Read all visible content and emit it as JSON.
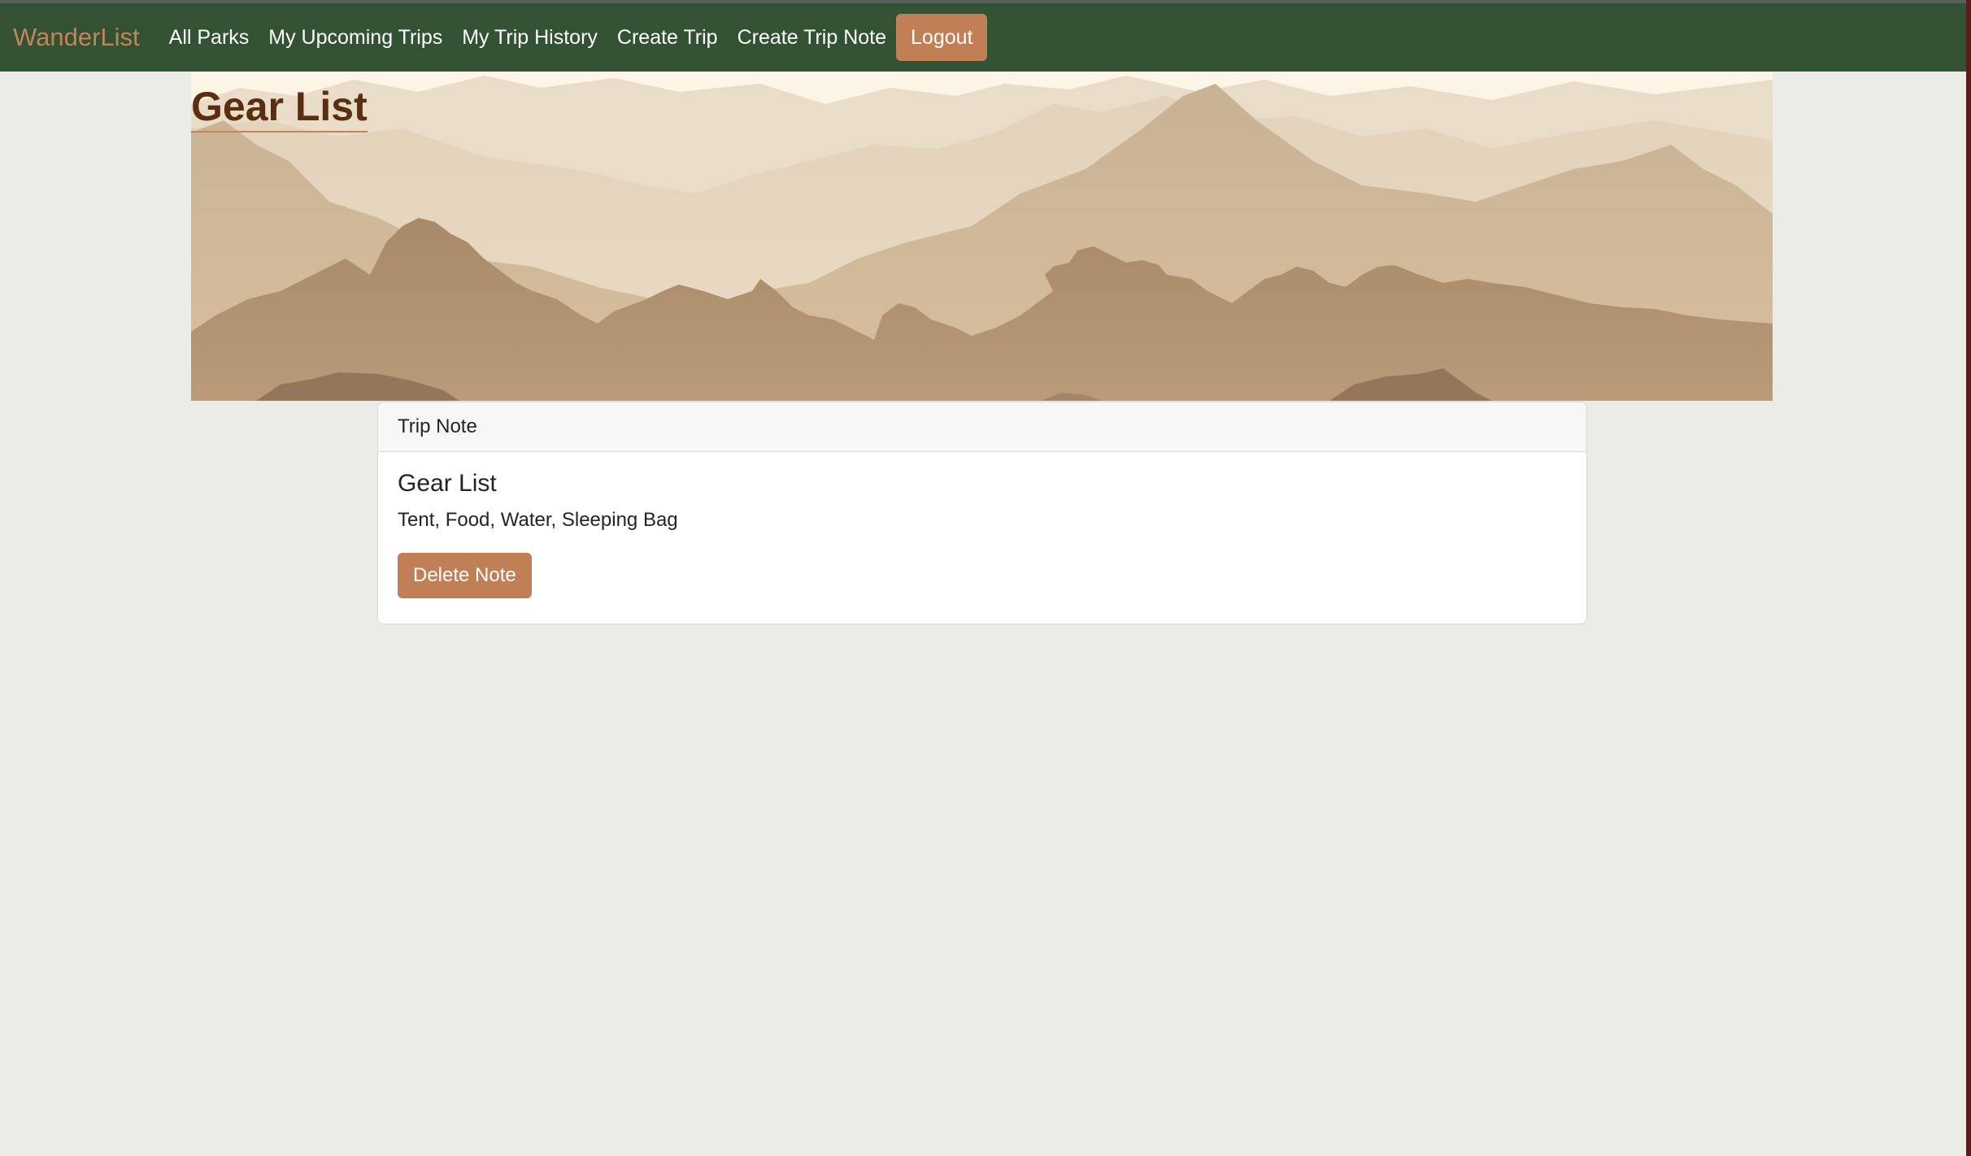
{
  "navbar": {
    "brand": "WanderList",
    "links": [
      "All Parks",
      "My Upcoming Trips",
      "My Trip History",
      "Create Trip",
      "Create Trip Note"
    ],
    "logout_label": "Logout"
  },
  "banner": {
    "title": "Gear List"
  },
  "note_card": {
    "header": "Trip Note",
    "title": "Gear List",
    "text": "Tent, Food, Water, Sleeping Bag",
    "delete_label": "Delete Note"
  },
  "colors": {
    "navbar_bg": "#335233",
    "brand": "#c48458",
    "accent_button": "#c17f55",
    "page_bg": "#ecece6",
    "banner_title": "#5a2e10"
  }
}
